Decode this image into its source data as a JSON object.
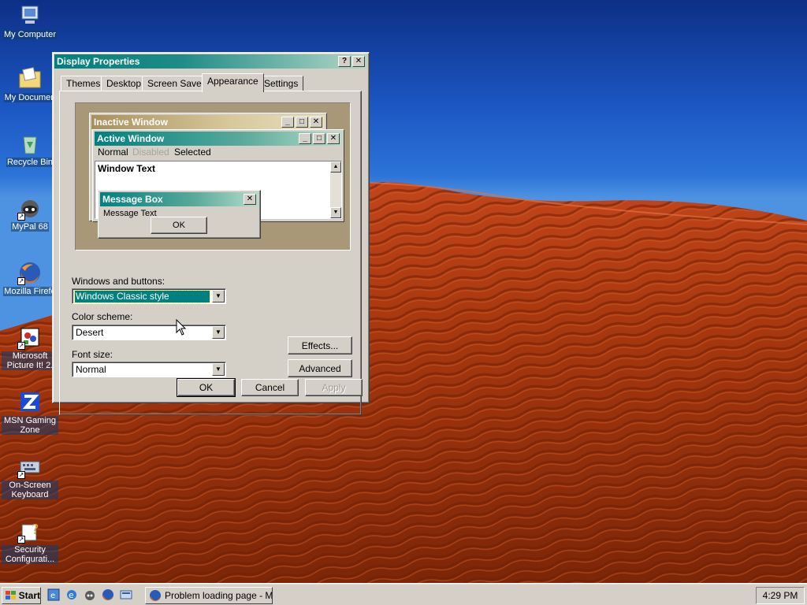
{
  "desktop": {
    "icons": [
      {
        "name": "my-computer",
        "label": "My Computer",
        "icon": "computer-icon"
      },
      {
        "name": "my-documents",
        "label": "My Documen",
        "icon": "folder-icon"
      },
      {
        "name": "recycle-bin",
        "label": "Recycle Bin",
        "icon": "recycle-bin-icon"
      },
      {
        "name": "mypal",
        "label": "MyPal 68",
        "icon": "raccoon-icon"
      },
      {
        "name": "firefox",
        "label": "Mozilla Firefo",
        "icon": "firefox-icon"
      },
      {
        "name": "picture-it",
        "label": "Microsoft Picture It! 2.",
        "icon": "picture-it-icon"
      },
      {
        "name": "msn-gaming",
        "label": "MSN Gaming Zone",
        "icon": "msn-zone-icon"
      },
      {
        "name": "osk",
        "label": "On-Screen Keyboard",
        "icon": "keyboard-icon"
      },
      {
        "name": "security-config",
        "label": "Security Configurati...",
        "icon": "security-icon"
      }
    ]
  },
  "dialog": {
    "title": "Display Properties",
    "help_btn": "?",
    "close_btn": "✕",
    "tabs": [
      "Themes",
      "Desktop",
      "Screen Saver",
      "Appearance",
      "Settings"
    ],
    "active_tab": "Appearance",
    "preview": {
      "inactive_title": "Inactive Window",
      "active_title": "Active Window",
      "menu": {
        "normal": "Normal",
        "disabled": "Disabled",
        "selected": "Selected"
      },
      "window_text": "Window Text",
      "msgbox_title": "Message Box",
      "msgbox_text": "Message Text",
      "msgbox_ok": "OK"
    },
    "windows_buttons_label": "Windows and buttons:",
    "windows_buttons_value": "Windows Classic style",
    "color_scheme_label": "Color scheme:",
    "color_scheme_value": "Desert",
    "font_size_label": "Font size:",
    "font_size_value": "Normal",
    "effects_btn": "Effects...",
    "advanced_btn": "Advanced",
    "ok_btn": "OK",
    "cancel_btn": "Cancel",
    "apply_btn": "Apply"
  },
  "taskbar": {
    "start_label": "Start",
    "quick_launch": [
      "ie-settings-icon",
      "internet-explorer-icon",
      "raccoon-icon",
      "firefox-icon",
      "desktop-icon"
    ],
    "task_label": "Problem loading page - M...",
    "clock": "4:29 PM"
  },
  "colors": {
    "titlebar_active": "#008080",
    "titlebar_inactive": "#a8905c",
    "dialog_face": "#d4d0c8",
    "preview_bg": "#a89878"
  }
}
